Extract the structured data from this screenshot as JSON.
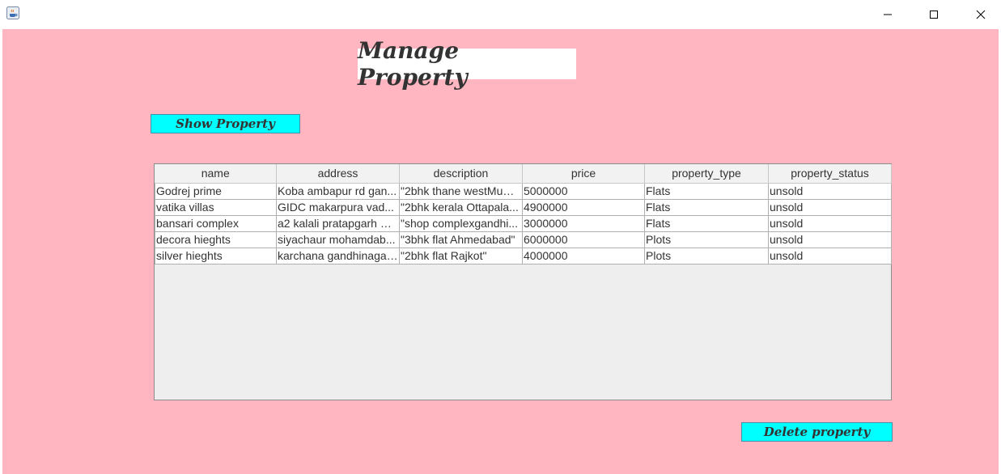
{
  "window": {
    "app_icon": "java-cup-icon",
    "controls": [
      "minimize-icon",
      "maximize-icon",
      "close-icon"
    ]
  },
  "colors": {
    "background": "#ffb6c1",
    "button": "#00ffff",
    "title_box": "#ffffff"
  },
  "page": {
    "title": "Manage Property",
    "show_button": "Show Property",
    "delete_button": "Delete property"
  },
  "table": {
    "columns": [
      "name",
      "address",
      "description",
      "price",
      "property_type",
      "property_status"
    ],
    "rows": [
      [
        "Godrej prime",
        "Koba ambapur rd gan...",
        "\"2bhk thane westMum...",
        "5000000",
        "Flats",
        "unsold"
      ],
      [
        "vatika villas",
        "GIDC makarpura vad...",
        "\"2bhk kerala Ottapala...",
        "4900000",
        "Flats",
        "unsold"
      ],
      [
        "bansari complex",
        "a2 kalali pratapgarh M...",
        "\"shop complexgandhi...",
        "3000000",
        "Flats",
        "unsold"
      ],
      [
        "decora hieghts",
        "siyachaur mohamdab...",
        "\"3bhk flat Ahmedabad\"",
        "6000000",
        "Plots",
        "unsold"
      ],
      [
        "silver hieghts",
        "karchana gandhinagar...",
        "\"2bhk flat Rajkot\"",
        "4000000",
        "Plots",
        "unsold"
      ]
    ]
  }
}
